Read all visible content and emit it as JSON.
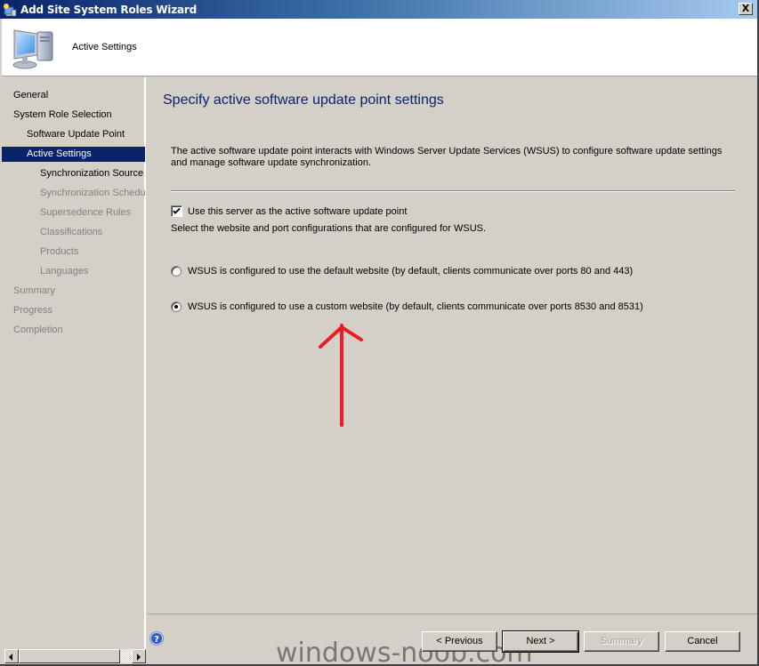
{
  "window": {
    "title": "Add Site System Roles Wizard",
    "close_label": "X"
  },
  "header": {
    "title": "Active Settings",
    "icon": "computer-icon"
  },
  "sidebar": {
    "items": [
      {
        "label": "General",
        "level": 1,
        "state": "normal"
      },
      {
        "label": "System Role Selection",
        "level": 1,
        "state": "normal"
      },
      {
        "label": "Software Update Point",
        "level": 2,
        "state": "normal"
      },
      {
        "label": "Active Settings",
        "level": 2,
        "state": "active"
      },
      {
        "label": "Synchronization Source",
        "level": 3,
        "state": "normal"
      },
      {
        "label": "Synchronization Schedule",
        "level": 3,
        "state": "disabled"
      },
      {
        "label": "Supersedence Rules",
        "level": 3,
        "state": "disabled"
      },
      {
        "label": "Classifications",
        "level": 3,
        "state": "disabled"
      },
      {
        "label": "Products",
        "level": 3,
        "state": "disabled"
      },
      {
        "label": "Languages",
        "level": 3,
        "state": "disabled"
      },
      {
        "label": "Summary",
        "level": 1,
        "state": "disabled"
      },
      {
        "label": "Progress",
        "level": 1,
        "state": "disabled"
      },
      {
        "label": "Completion",
        "level": 1,
        "state": "disabled"
      }
    ]
  },
  "main": {
    "page_title": "Specify active software update point settings",
    "description": "The active software update point interacts with Windows Server Update Services (WSUS) to configure software update settings and manage software update synchronization.",
    "use_server_checkbox": {
      "label": "Use this server as the active software update point",
      "checked": true
    },
    "select_text": "Select the website and port configurations that are configured for WSUS.",
    "radio_options": [
      {
        "label": "WSUS is configured to use the default website (by default, clients communicate over ports 80 and 443)",
        "selected": false
      },
      {
        "label": "WSUS is configured to use a custom website (by default, clients communicate over ports 8530 and 8531)",
        "selected": true
      }
    ],
    "annotation_color": "#ed1c24"
  },
  "footer": {
    "help_icon": "help-icon",
    "previous_label": "< Previous",
    "next_label": "Next >",
    "summary_label": "Summary",
    "cancel_label": "Cancel"
  },
  "watermark": "windows-noob.com",
  "colors": {
    "title_gradient_start": "#0a246a",
    "title_gradient_end": "#a6caf0",
    "selection": "#0a246a",
    "heading": "#0a246a",
    "disabled_text": "#808080",
    "face": "#d4d0c8"
  }
}
